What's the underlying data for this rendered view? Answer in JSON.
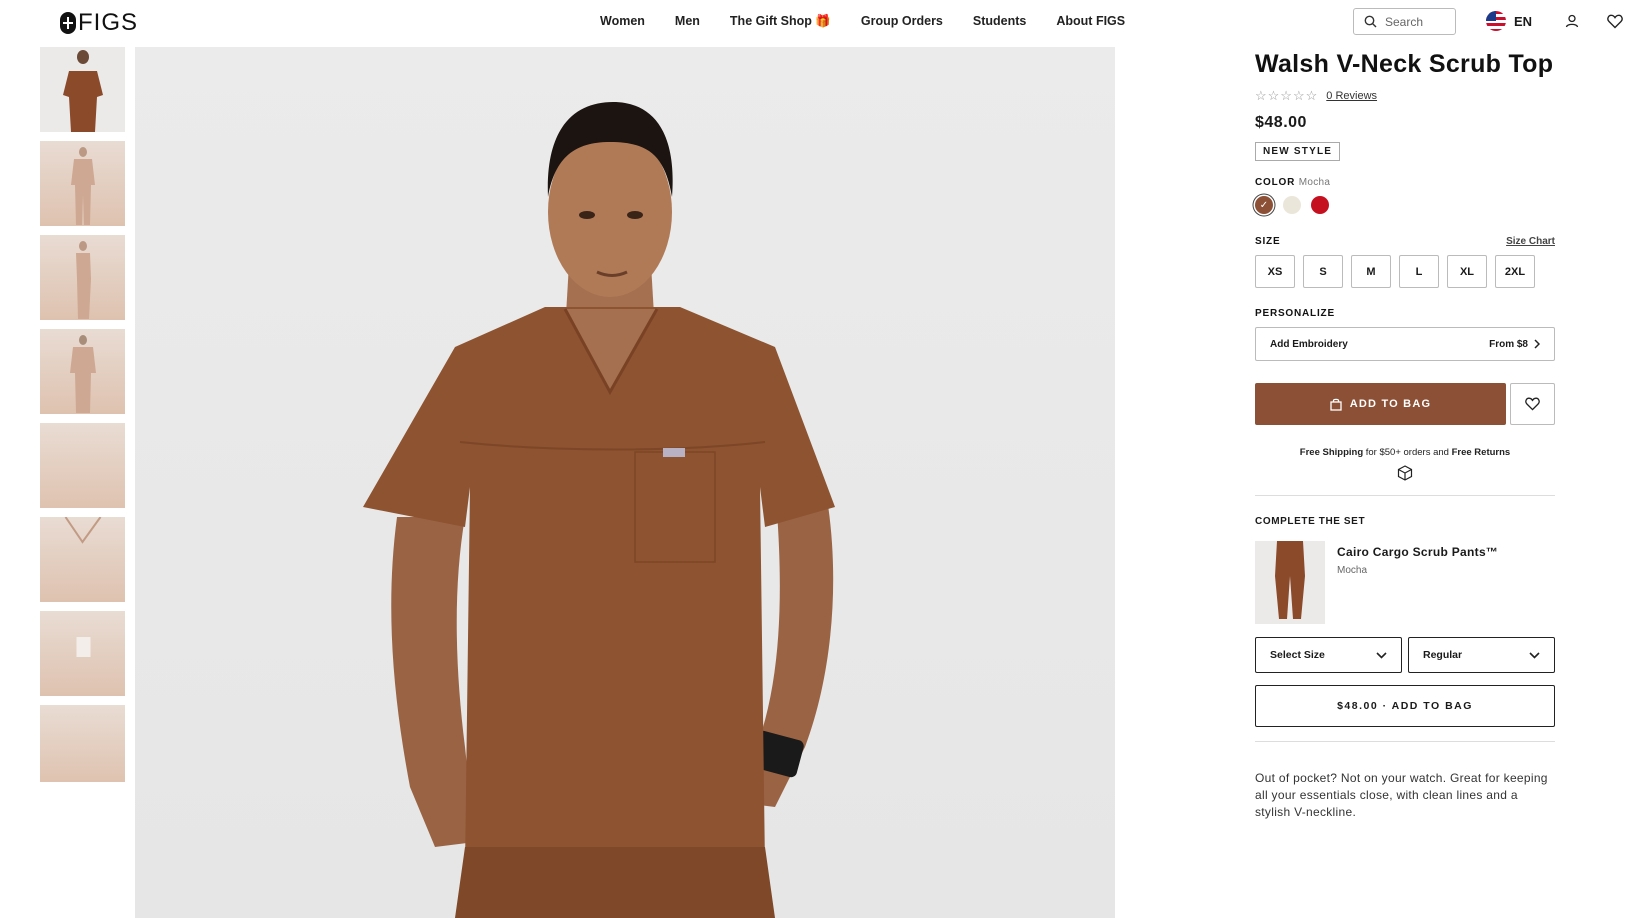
{
  "header": {
    "logo": "FIGS",
    "nav": [
      "Women",
      "Men",
      "The Gift Shop",
      "Group Orders",
      "Students",
      "About FIGS"
    ],
    "search_placeholder": "Search",
    "language": "EN",
    "icons": [
      "search-icon",
      "flag-us-icon",
      "account-icon",
      "heart-icon",
      "gift-icon"
    ]
  },
  "gallery": {
    "thumbnail_count": 8
  },
  "product": {
    "title": "Walsh V-Neck Scrub Top",
    "reviews": "0 Reviews",
    "price": "$48.00",
    "badge": "NEW STYLE",
    "color_label": "COLOR",
    "color_value": "Mocha",
    "colors": [
      {
        "name": "Mocha",
        "hex": "#8b5035",
        "selected": true
      },
      {
        "name": "Cream",
        "hex": "#ebe6da",
        "selected": false
      },
      {
        "name": "Red",
        "hex": "#c4101f",
        "selected": false
      }
    ],
    "size_label": "SIZE",
    "size_chart": "Size Chart",
    "sizes": [
      "XS",
      "S",
      "M",
      "L",
      "XL",
      "2XL"
    ],
    "personalize_label": "PERSONALIZE",
    "embroidery_label": "Add Embroidery",
    "embroidery_price": "From $8",
    "add_to_bag": "ADD TO BAG",
    "shipping_free": "Free Shipping",
    "shipping_mid": " for $50+ orders and ",
    "shipping_returns": "Free Returns"
  },
  "complete_set": {
    "title": "COMPLETE THE SET",
    "item_name": "Cairo Cargo Scrub Pants™",
    "item_color": "Mocha",
    "size_select": "Select Size",
    "length_select": "Regular",
    "add_button": "$48.00 · ADD TO BAG"
  },
  "description": "Out of pocket? Not on your watch. Great for keeping all your essentials close, with clean lines and a stylish V-neckline.",
  "colors": {
    "accent": "#8b5035",
    "gift_nav": "#8a3e2a"
  }
}
